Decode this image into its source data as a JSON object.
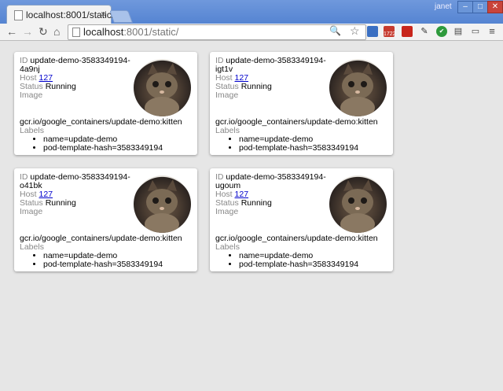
{
  "browser": {
    "tab_title": "localhost:8001/static/",
    "tab_close": "×",
    "username": "janet",
    "window_buttons": {
      "minimize": "–",
      "maximize": "□",
      "close": "✕"
    },
    "url_host": "localhost",
    "url_rest": ":8001/static/",
    "nav": {
      "back": "←",
      "forward": "→",
      "reload": "↻",
      "home": "⌂"
    },
    "omnibox_icons": {
      "zoom": "🔍",
      "star": "☆"
    },
    "extension_badge": "1722",
    "menu": "≡"
  },
  "pods": [
    {
      "id_label": "ID",
      "id": "update-demo-3583349194-4a9nj",
      "host_label": "Host",
      "host": "127",
      "status_label": "Status",
      "status": "Running",
      "image_label": "Image",
      "image": "gcr.io/google_containers/update-demo:kitten",
      "labels_label": "Labels",
      "labels": [
        "name=update-demo",
        "pod-template-hash=3583349194"
      ]
    },
    {
      "id_label": "ID",
      "id": "update-demo-3583349194-igt1v",
      "host_label": "Host",
      "host": "127",
      "status_label": "Status",
      "status": "Running",
      "image_label": "Image",
      "image": "gcr.io/google_containers/update-demo:kitten",
      "labels_label": "Labels",
      "labels": [
        "name=update-demo",
        "pod-template-hash=3583349194"
      ]
    },
    {
      "id_label": "ID",
      "id": "update-demo-3583349194-o41bk",
      "host_label": "Host",
      "host": "127",
      "status_label": "Status",
      "status": "Running",
      "image_label": "Image",
      "image": "gcr.io/google_containers/update-demo:kitten",
      "labels_label": "Labels",
      "labels": [
        "name=update-demo",
        "pod-template-hash=3583349194"
      ]
    },
    {
      "id_label": "ID",
      "id": "update-demo-3583349194-ugoum",
      "host_label": "Host",
      "host": "127",
      "status_label": "Status",
      "status": "Running",
      "image_label": "Image",
      "image": "gcr.io/google_containers/update-demo:kitten",
      "labels_label": "Labels",
      "labels": [
        "name=update-demo",
        "pod-template-hash=3583349194"
      ]
    }
  ]
}
